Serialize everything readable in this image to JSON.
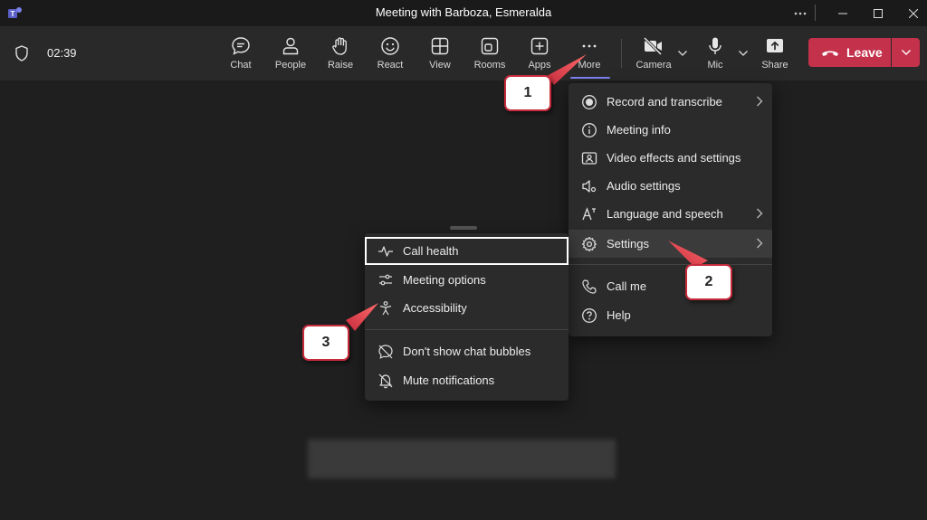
{
  "window": {
    "title": "Meeting with Barboza, Esmeralda"
  },
  "toolbar": {
    "timer": "02:39",
    "buttons": [
      {
        "label": "Chat"
      },
      {
        "label": "People"
      },
      {
        "label": "Raise"
      },
      {
        "label": "React"
      },
      {
        "label": "View"
      },
      {
        "label": "Rooms"
      },
      {
        "label": "Apps"
      },
      {
        "label": "More"
      },
      {
        "label": "Camera"
      },
      {
        "label": "Mic"
      },
      {
        "label": "Share"
      }
    ],
    "leave_label": "Leave"
  },
  "more_menu": {
    "items": [
      {
        "label": "Record and transcribe"
      },
      {
        "label": "Meeting info"
      },
      {
        "label": "Video effects and settings"
      },
      {
        "label": "Audio settings"
      },
      {
        "label": "Language and speech"
      },
      {
        "label": "Settings"
      },
      {
        "label": "Call me"
      },
      {
        "label": "Help"
      }
    ]
  },
  "settings_menu": {
    "items": [
      {
        "label": "Call health"
      },
      {
        "label": "Meeting options"
      },
      {
        "label": "Accessibility"
      },
      {
        "label": "Don't show chat bubbles"
      },
      {
        "label": "Mute notifications"
      }
    ]
  },
  "callouts": [
    "1",
    "2",
    "3"
  ],
  "colors": {
    "accent": "#7f85f5",
    "leave": "#c4314b",
    "callout_border": "#c62b3c"
  }
}
